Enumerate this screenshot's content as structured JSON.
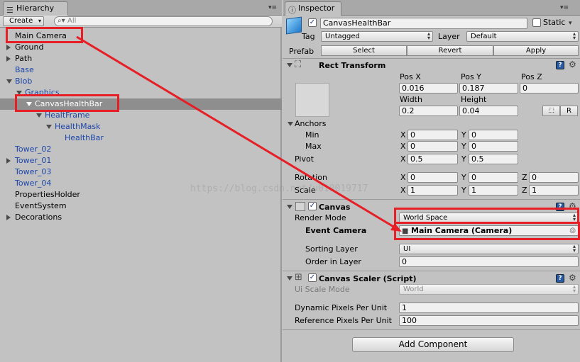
{
  "hierarchy": {
    "tab_label": "Hierarchy",
    "create_label": "Create",
    "search_placeholder": "All",
    "items": [
      {
        "label": "Main Camera",
        "color": "black"
      },
      {
        "label": "Ground",
        "color": "black"
      },
      {
        "label": "Path",
        "color": "black"
      },
      {
        "label": "Base",
        "color": "blue"
      },
      {
        "label": "Blob",
        "color": "blue"
      },
      {
        "label": "Graphics",
        "color": "blue"
      },
      {
        "label": "CanvasHealthBar",
        "color": "white",
        "selected": true
      },
      {
        "label": "HealtFrame",
        "color": "blue"
      },
      {
        "label": "HealthMask",
        "color": "blue"
      },
      {
        "label": "HealthBar",
        "color": "blue"
      },
      {
        "label": "Tower_02",
        "color": "blue"
      },
      {
        "label": "Tower_01",
        "color": "blue"
      },
      {
        "label": "Tower_03",
        "color": "blue"
      },
      {
        "label": "Tower_04",
        "color": "blue"
      },
      {
        "label": "PropertiesHolder",
        "color": "black"
      },
      {
        "label": "EventSystem",
        "color": "black"
      },
      {
        "label": "Decorations",
        "color": "black"
      }
    ]
  },
  "inspector": {
    "tab_label": "Inspector",
    "object_name": "CanvasHealthBar",
    "static_label": "Static",
    "tag_label": "Tag",
    "tag_value": "Untagged",
    "layer_label": "Layer",
    "layer_value": "Default",
    "prefab_label": "Prefab",
    "prefab_select": "Select",
    "prefab_revert": "Revert",
    "prefab_apply": "Apply",
    "rect_transform": {
      "title": "Rect Transform",
      "posx_label": "Pos X",
      "posy_label": "Pos Y",
      "posz_label": "Pos Z",
      "posx": "0.016",
      "posy": "0.187",
      "posz": "0",
      "width_label": "Width",
      "height_label": "Height",
      "width": "0.2",
      "height": "0.04",
      "r_button": "R",
      "anchors_label": "Anchors",
      "min_label": "Min",
      "max_label": "Max",
      "min_x": "0",
      "min_y": "0",
      "max_x": "0",
      "max_y": "0",
      "pivot_label": "Pivot",
      "pivot_x": "0.5",
      "pivot_y": "0.5",
      "rotation_label": "Rotation",
      "rot_x": "0",
      "rot_y": "0",
      "rot_z": "0",
      "scale_label": "Scale",
      "scale_x": "1",
      "scale_y": "1",
      "scale_z": "1",
      "x": "X",
      "y": "Y",
      "z": "Z"
    },
    "canvas": {
      "title": "Canvas",
      "render_mode_label": "Render Mode",
      "render_mode_value": "World Space",
      "event_camera_label": "Event Camera",
      "event_camera_value": "Main Camera (Camera)",
      "sorting_layer_label": "Sorting Layer",
      "sorting_layer_value": "UI",
      "order_label": "Order in Layer",
      "order_value": "0"
    },
    "canvas_scaler": {
      "title": "Canvas Scaler (Script)",
      "ui_scale_label": "Ui Scale Mode",
      "ui_scale_value": "World",
      "dpp_label": "Dynamic Pixels Per Unit",
      "dpp_value": "1",
      "rpp_label": "Reference Pixels Per Unit",
      "rpp_value": "100"
    },
    "add_component_label": "Add Component"
  },
  "watermark": "https://blog.csdn.net/u010019717",
  "colors": {
    "annotation": "#e61e26",
    "selection": "#8e8e8e",
    "prefab_blue": "#1c46a8"
  }
}
